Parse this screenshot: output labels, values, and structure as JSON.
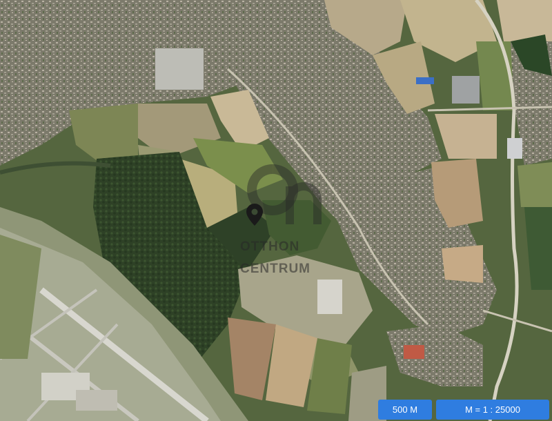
{
  "map": {
    "view": "satellite",
    "marker_icon": "location-pin-icon",
    "marker_color": "#1a1a1a",
    "watermark": {
      "line1": "OTTHON",
      "line2": "CENTRUM"
    },
    "scale": {
      "distance_label": "500 M",
      "ratio_label": "M = 1 : 25000",
      "accent_color": "#2f7de0"
    }
  }
}
